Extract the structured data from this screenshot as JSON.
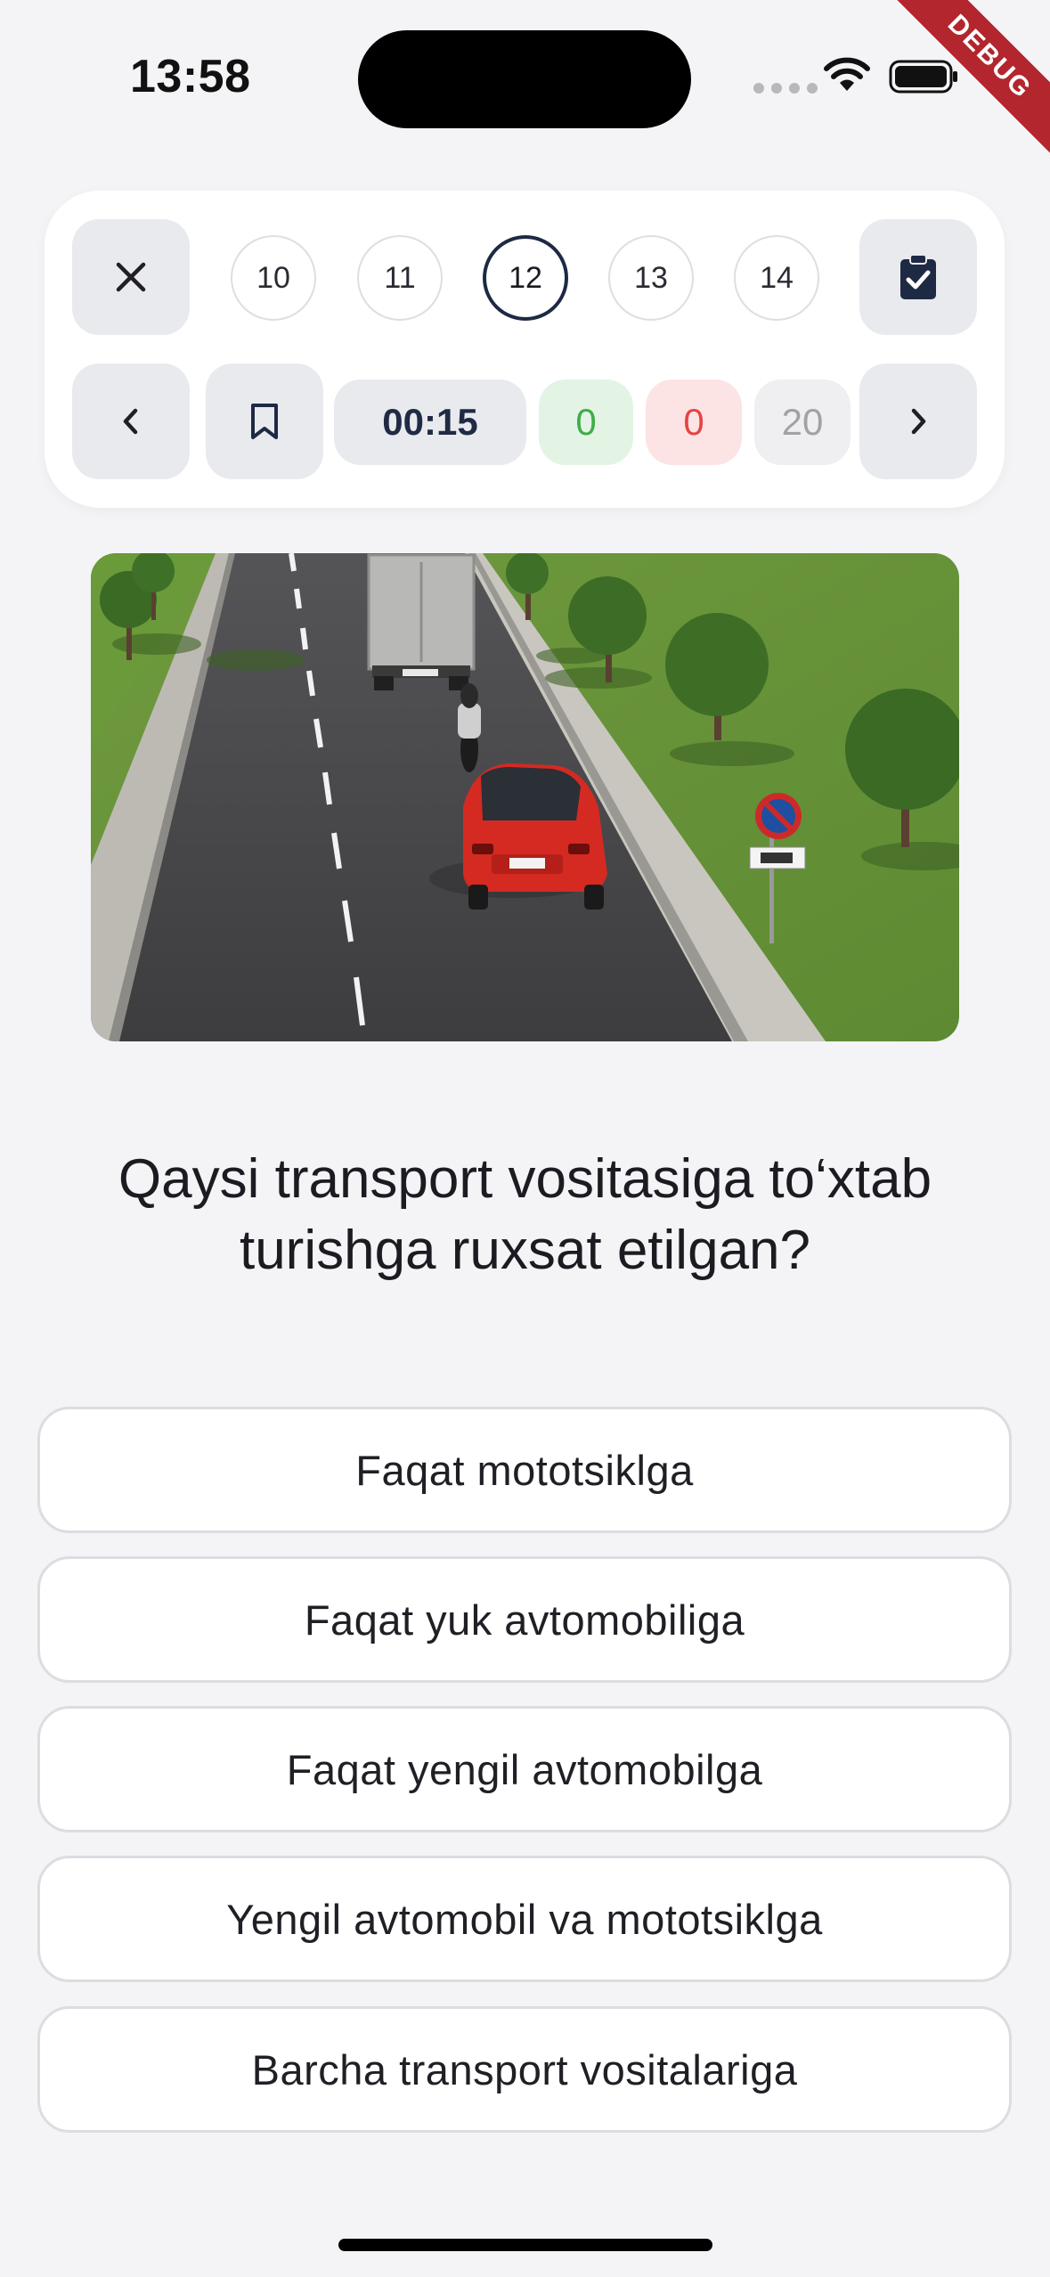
{
  "status_bar": {
    "time": "13:58",
    "icons": [
      "signal-dots-icon",
      "wifi-icon",
      "battery-icon"
    ],
    "debug_label": "DEBUG"
  },
  "controls": {
    "close_icon": "close-icon",
    "question_numbers": [
      "10",
      "11",
      "12",
      "13",
      "14"
    ],
    "active_question": "12",
    "finish_icon": "clipboard-check-icon",
    "prev_icon": "chevron-left-icon",
    "bookmark_icon": "bookmark-icon",
    "timer": "00:15",
    "correct_count": "0",
    "wrong_count": "0",
    "total_count": "20",
    "next_icon": "chevron-right-icon"
  },
  "question": {
    "text": "Qaysi transport vositasiga to‘xtab turishga ruxsat etilgan?"
  },
  "answers": [
    "Faqat mototsiklga",
    "Faqat yuk avtomobiliga",
    "Faqat yengil avtomobilga",
    "Yengil avtomobil va mototsiklga",
    "Barcha transport vositalariga"
  ],
  "colors": {
    "accent": "#1e2a44",
    "correct_bg": "#e3f4e5",
    "correct_text": "#3fae4a",
    "wrong_bg": "#fde4e4",
    "wrong_text": "#e74444",
    "background": "#f4f4f6"
  }
}
